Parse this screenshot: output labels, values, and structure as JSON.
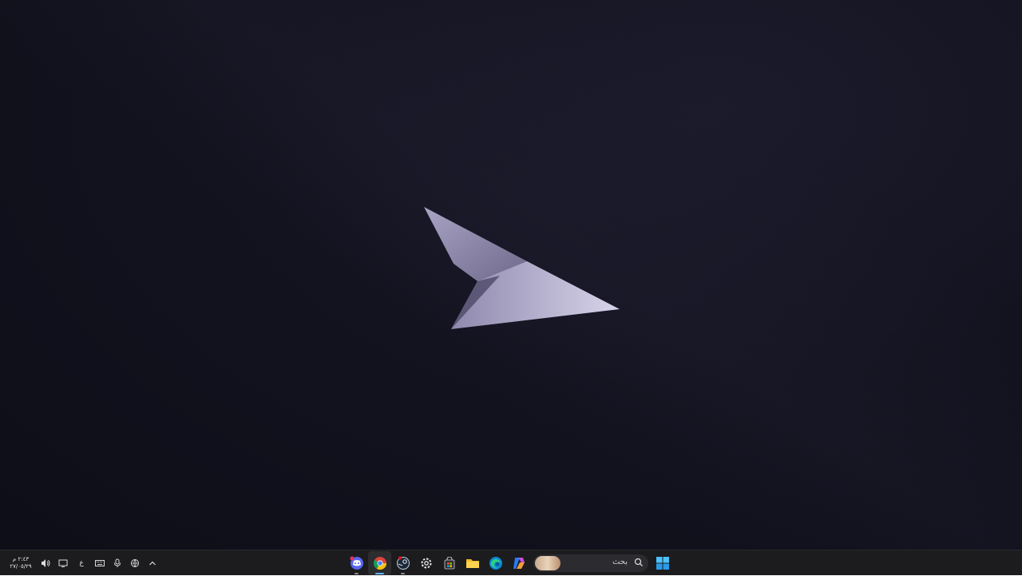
{
  "taskbar": {
    "clock": {
      "time": "٢:٤٣ م",
      "date": "٢٧/٠٥/٢٩"
    },
    "language": "ع",
    "search": {
      "placeholder": "بحث"
    },
    "tray_icons": [
      "volume-icon",
      "display-icon",
      "language-indicator",
      "keyboard-icon",
      "microphone-icon",
      "network-icon",
      "chevron-up-icon"
    ],
    "apps": [
      "discord-icon",
      "chrome-icon",
      "steam-icon",
      "settings-icon",
      "store-icon",
      "file-explorer-icon",
      "edge-icon",
      "copilot-icon"
    ],
    "start": "windows-icon"
  },
  "colors": {
    "taskbar_bg": "#1c1c1f",
    "accent": "#5fb2ff",
    "desktop_bg": "#131320"
  }
}
